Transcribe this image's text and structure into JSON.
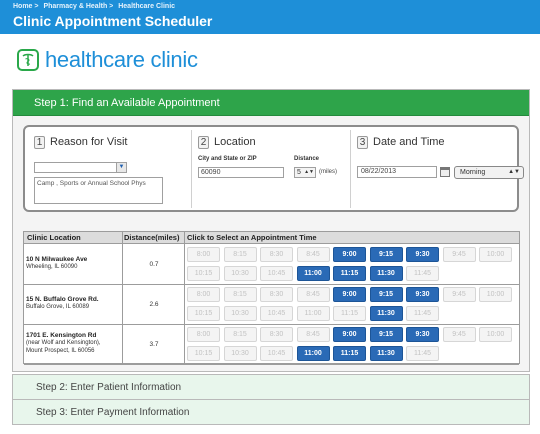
{
  "header": {
    "breadcrumbs": [
      "Home >",
      "Pharmacy & Health >",
      "Healthcare Clinic"
    ],
    "title": "Clinic Appointment Scheduler"
  },
  "logo": {
    "text": "healthcare clinic",
    "icon": "caduceus-icon"
  },
  "step1": {
    "title": "Step 1: Find an Available Appointment",
    "reason": {
      "number": "1",
      "label": "Reason for Visit",
      "selected_value": "",
      "description": "Camp , Sports or Annual School Phys"
    },
    "location": {
      "number": "2",
      "label": "Location",
      "city_label": "City and State or ZIP",
      "city_value": "60090",
      "distance_label": "Distance",
      "distance_value": "5",
      "distance_unit": "(miles)"
    },
    "datetime": {
      "number": "3",
      "label": "Date and Time",
      "date_value": "08/22/2013",
      "time_value": "Morning"
    },
    "grid": {
      "headers": {
        "location": "Clinic Location",
        "distance": "Distance(miles)",
        "times": "Click to Select an Appointment Time"
      },
      "rows": [
        {
          "lines": [
            "10 N Milwaukee Ave",
            "Wheeling, IL 60090"
          ],
          "distance": "0.7",
          "times_row1": [
            [
              "8:00",
              false
            ],
            [
              "8:15",
              false
            ],
            [
              "8:30",
              false
            ],
            [
              "8:45",
              false
            ],
            [
              "9:00",
              true
            ],
            [
              "9:15",
              true
            ],
            [
              "9:30",
              true
            ],
            [
              "9:45",
              false
            ],
            [
              "10:00",
              false
            ]
          ],
          "times_row2": [
            [
              "10:15",
              false
            ],
            [
              "10:30",
              false
            ],
            [
              "10:45",
              false
            ],
            [
              "11:00",
              true
            ],
            [
              "11:15",
              true
            ],
            [
              "11:30",
              true
            ],
            [
              "11:45",
              false
            ]
          ]
        },
        {
          "lines": [
            "15 N. Buffalo Grove Rd.",
            "Buffalo Grove, IL 60089"
          ],
          "distance": "2.6",
          "times_row1": [
            [
              "8:00",
              false
            ],
            [
              "8:15",
              false
            ],
            [
              "8:30",
              false
            ],
            [
              "8:45",
              false
            ],
            [
              "9:00",
              true
            ],
            [
              "9:15",
              true
            ],
            [
              "9:30",
              true
            ],
            [
              "9:45",
              false
            ],
            [
              "10:00",
              false
            ]
          ],
          "times_row2": [
            [
              "10:15",
              false
            ],
            [
              "10:30",
              false
            ],
            [
              "10:45",
              false
            ],
            [
              "11:00",
              false
            ],
            [
              "11:15",
              false
            ],
            [
              "11:30",
              true
            ],
            [
              "11:45",
              false
            ]
          ]
        },
        {
          "lines": [
            "1701 E. Kensington Rd",
            "(near Wolf and Kensington),",
            "Mount Prospect, IL 60056"
          ],
          "distance": "3.7",
          "times_row1": [
            [
              "8:00",
              false
            ],
            [
              "8:15",
              false
            ],
            [
              "8:30",
              false
            ],
            [
              "8:45",
              false
            ],
            [
              "9:00",
              true
            ],
            [
              "9:15",
              true
            ],
            [
              "9:30",
              true
            ],
            [
              "9:45",
              false
            ],
            [
              "10:00",
              false
            ]
          ],
          "times_row2": [
            [
              "10:15",
              false
            ],
            [
              "10:30",
              false
            ],
            [
              "10:45",
              false
            ],
            [
              "11:00",
              true
            ],
            [
              "11:15",
              true
            ],
            [
              "11:30",
              true
            ],
            [
              "11:45",
              false
            ]
          ]
        }
      ]
    }
  },
  "step2": {
    "title": "Step 2: Enter Patient Information"
  },
  "step3": {
    "title": "Step 3: Enter Payment Information"
  },
  "colors": {
    "header_blue": "#1e8fd8",
    "step_green": "#2ea44a",
    "slot_available": "#2a6ab6",
    "step_pending_bg": "#e8f6ec"
  }
}
